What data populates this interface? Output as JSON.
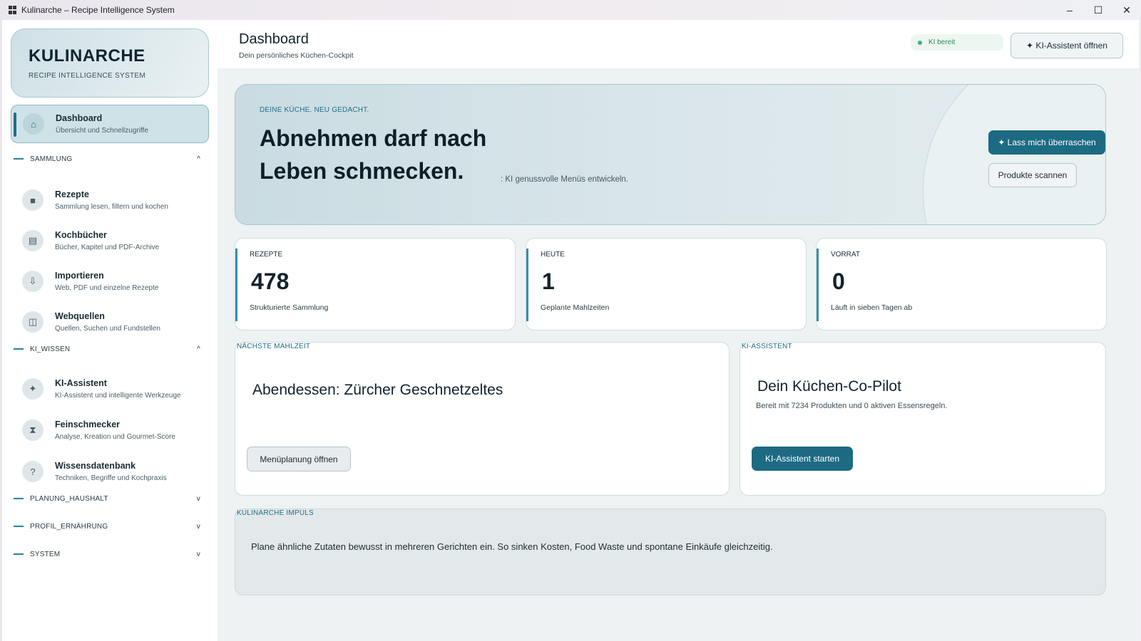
{
  "window": {
    "title": "Kulinarche – Recipe Intelligence System",
    "controls": {
      "minimize": "–",
      "maximize": "☐",
      "close": "✕"
    }
  },
  "brand": {
    "title": "KULINARCHE",
    "subtitle": "RECIPE INTELLIGENCE SYSTEM"
  },
  "sidebar": {
    "dashboard": {
      "label": "Dashboard",
      "desc": "Übersicht und Schnellzugriffe",
      "icon": "home-icon"
    },
    "sections": [
      {
        "label": "SAMMLUNG",
        "state": "^"
      },
      {
        "label": "KI_WISSEN",
        "state": "^"
      },
      {
        "label": "PLANUNG_HAUSHALT",
        "state": "v"
      },
      {
        "label": "PROFIL_ERNÄHRUNG",
        "state": "v"
      },
      {
        "label": "SYSTEM",
        "state": "v"
      }
    ],
    "items": [
      {
        "label": "Rezepte",
        "desc": "Sammlung lesen, filtern und kochen",
        "icon": "■"
      },
      {
        "label": "Kochbücher",
        "desc": "Bücher, Kapitel und PDF-Archive",
        "icon": "▤"
      },
      {
        "label": "Importieren",
        "desc": "Web, PDF und einzelne Rezepte",
        "icon": "⇩"
      },
      {
        "label": "Webquellen",
        "desc": "Quellen, Suchen und Fundstellen",
        "icon": "◫"
      },
      {
        "label": "KI-Assistent",
        "desc": "KI-Assistent und intelligente Werkzeuge",
        "icon": "✦"
      },
      {
        "label": "Feinschmecker",
        "desc": "Analyse, Kreation und Gourmet-Score",
        "icon": "⧗"
      },
      {
        "label": "Wissensdatenbank",
        "desc": "Techniken, Begriffe und Kochpraxis",
        "icon": "?"
      }
    ]
  },
  "header": {
    "title": "Dashboard",
    "subtitle": "Dein persönliches Küchen-Cockpit",
    "status": "KI bereit",
    "assistant_button": "✦  KI-Assistent öffnen"
  },
  "hero": {
    "kicker": "DEINE KÜCHE. NEU GEDACHT.",
    "headline": "Abnehmen darf nach Leben schmecken.",
    "note": ": KI genussvolle Menüs entwickeln.",
    "surprise_button": "✦  Lass mich überraschen",
    "scan_button": "Produkte scannen"
  },
  "stats": [
    {
      "label": "REZEPTE",
      "value": "478",
      "desc": "Strukturierte Sammlung"
    },
    {
      "label": "HEUTE",
      "value": "1",
      "desc": "Geplante Mahlzeiten"
    },
    {
      "label": "VORRAT",
      "value": "0",
      "desc": "Läuft in sieben Tagen ab"
    }
  ],
  "next_meal": {
    "kicker": "NÄCHSTE MAHLZEIT",
    "title": "Abendessen: Zürcher Geschnetzeltes",
    "button": "Menüplanung öffnen"
  },
  "assistant": {
    "kicker": "KI-ASSISTENT",
    "title": "Dein Küchen-Co-Pilot",
    "subtitle": "Bereit mit 7234 Produkten und 0 aktiven Essensregeln.",
    "button": "KI-Assistent starten"
  },
  "impuls": {
    "kicker": "KULINARCHE IMPULS",
    "text": "Plane ähnliche Zutaten bewusst in mehreren Gerichten ein. So sinken Kosten, Food Waste und spontane Einkäufe gleichzeitig."
  }
}
